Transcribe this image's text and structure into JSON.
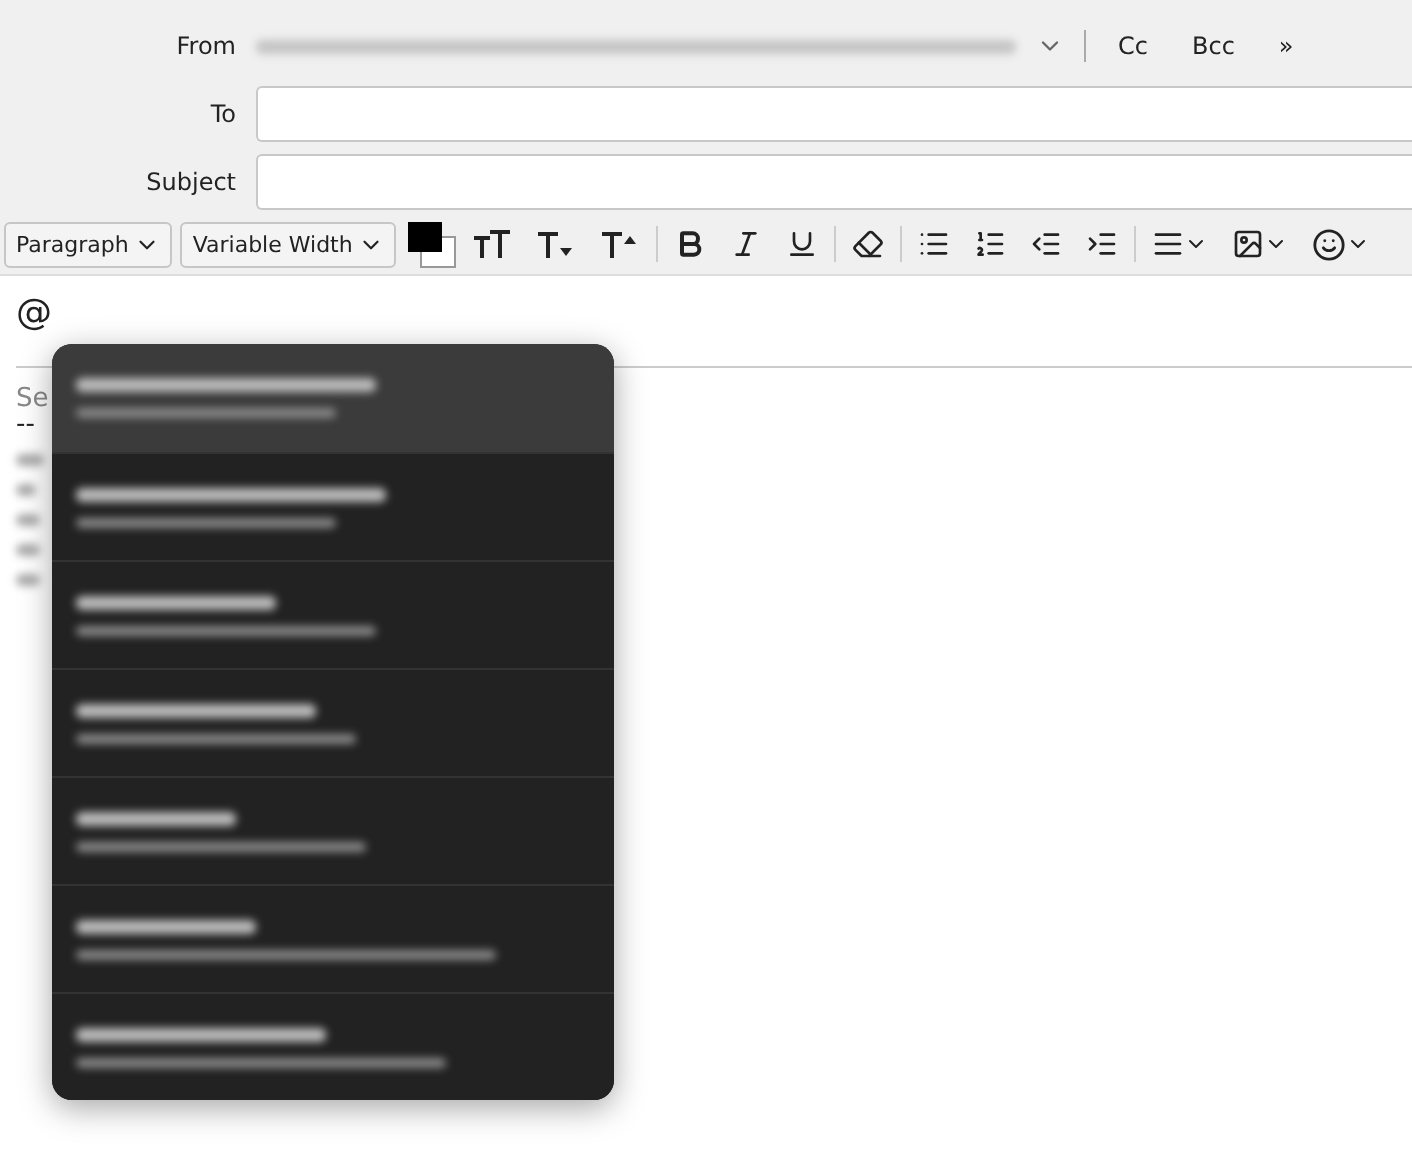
{
  "header": {
    "from_label": "From",
    "buttons": [
      "Cc",
      "Bcc",
      "»"
    ],
    "to_label": "To",
    "subject_label": "Subject"
  },
  "toolbar": {
    "paragraph": "Paragraph",
    "font": "Variable Width"
  },
  "body": {
    "typed": "@",
    "signature_start": "Se",
    "separator": "--"
  },
  "mention_popup": {
    "items": [
      {
        "selected": true
      },
      {
        "selected": false
      },
      {
        "selected": false
      },
      {
        "selected": false
      },
      {
        "selected": false
      },
      {
        "selected": false
      },
      {
        "selected": false
      }
    ]
  }
}
